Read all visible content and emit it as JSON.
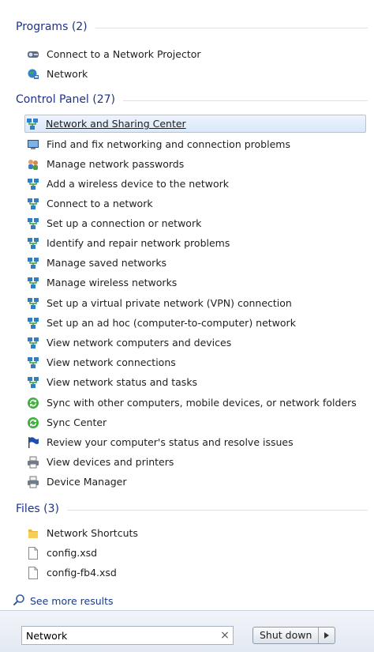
{
  "groups": {
    "programs": {
      "header": "Programs (2)",
      "items": [
        {
          "label": "Connect to a Network Projector",
          "icon": "projector-icon"
        },
        {
          "label": "Network",
          "icon": "network-globe-icon"
        }
      ]
    },
    "control_panel": {
      "header": "Control Panel (27)",
      "items": [
        {
          "label": "Network and Sharing Center",
          "icon": "network-icon"
        },
        {
          "label": "Find and fix networking and connection problems",
          "icon": "troubleshoot-icon"
        },
        {
          "label": "Manage network passwords",
          "icon": "users-icon"
        },
        {
          "label": "Add a wireless device to the network",
          "icon": "network-icon"
        },
        {
          "label": "Connect to a network",
          "icon": "network-icon"
        },
        {
          "label": "Set up a connection or network",
          "icon": "network-icon"
        },
        {
          "label": "Identify and repair network problems",
          "icon": "network-icon"
        },
        {
          "label": "Manage saved networks",
          "icon": "network-icon"
        },
        {
          "label": "Manage wireless networks",
          "icon": "network-icon"
        },
        {
          "label": "Set up a virtual private network (VPN) connection",
          "icon": "network-icon"
        },
        {
          "label": "Set up an ad hoc (computer-to-computer) network",
          "icon": "network-icon"
        },
        {
          "label": "View network computers and devices",
          "icon": "network-icon"
        },
        {
          "label": "View network connections",
          "icon": "network-icon"
        },
        {
          "label": "View network status and tasks",
          "icon": "network-icon"
        },
        {
          "label": "Sync with other computers, mobile devices, or network folders",
          "icon": "sync-icon"
        },
        {
          "label": "Sync Center",
          "icon": "sync-icon"
        },
        {
          "label": "Review your computer's status and resolve issues",
          "icon": "flag-icon"
        },
        {
          "label": "View devices and printers",
          "icon": "printer-icon"
        },
        {
          "label": "Device Manager",
          "icon": "printer-icon"
        }
      ]
    },
    "files": {
      "header": "Files (3)",
      "items": [
        {
          "label": "Network Shortcuts",
          "icon": "folder-icon"
        },
        {
          "label": "config.xsd",
          "icon": "file-icon"
        },
        {
          "label": "config-fb4.xsd",
          "icon": "file-icon"
        }
      ]
    }
  },
  "see_more": {
    "label": "See more results",
    "icon": "search-icon"
  },
  "search": {
    "value": "Network",
    "clear_icon": "clear-icon"
  },
  "shutdown": {
    "label": "Shut down",
    "arrow_icon": "chevron-right-icon"
  },
  "colors": {
    "header_text": "#1e3287",
    "link_text": "#1a3a8a",
    "selection_border": "#a9c5ea"
  }
}
